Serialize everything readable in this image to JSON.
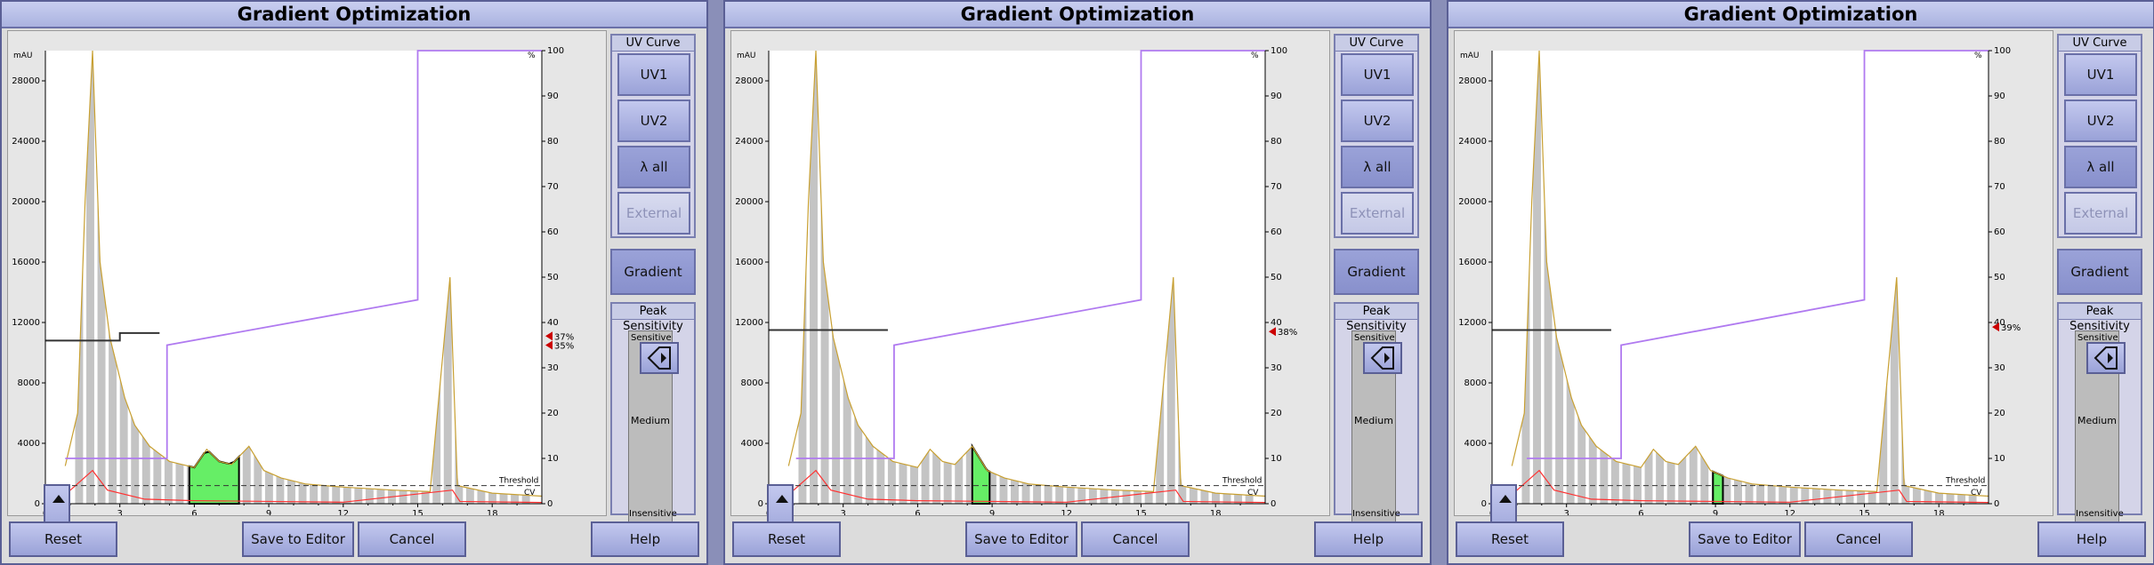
{
  "panels": [
    {
      "title": "Gradient Optimization",
      "left_axis_unit": "mAU",
      "right_axis_unit": "%",
      "threshold_label": "Threshold",
      "cv_label": "CV",
      "marker_labels": [
        "37%",
        "35%"
      ],
      "selected_peak_x": [
        5.8,
        7.8
      ],
      "uv_curve": {
        "label": "UV Curve",
        "buttons": [
          "UV1",
          "UV2",
          "λ all",
          "External"
        ],
        "pressed": [
          false,
          false,
          true,
          false
        ],
        "disabled": [
          false,
          false,
          false,
          true
        ]
      },
      "gradient_label": "Gradient",
      "peak_sensitivity": {
        "label": "Peak Sensitivity",
        "sensitive": "Sensitive",
        "medium": "Medium",
        "insensitive": "Insensitive"
      },
      "bottom_buttons": [
        "Reset",
        "Save to Editor",
        "Cancel",
        "Help"
      ]
    },
    {
      "title": "Gradient Optimization",
      "left_axis_unit": "mAU",
      "right_axis_unit": "%",
      "threshold_label": "Threshold",
      "cv_label": "CV",
      "marker_labels": [
        "38%"
      ],
      "selected_peak_x": [
        8.2,
        8.9
      ],
      "uv_curve": {
        "label": "UV Curve",
        "buttons": [
          "UV1",
          "UV2",
          "λ all",
          "External"
        ],
        "pressed": [
          false,
          false,
          true,
          false
        ],
        "disabled": [
          false,
          false,
          false,
          true
        ]
      },
      "gradient_label": "Gradient",
      "peak_sensitivity": {
        "label": "Peak Sensitivity",
        "sensitive": "Sensitive",
        "medium": "Medium",
        "insensitive": "Insensitive"
      },
      "bottom_buttons": [
        "Reset",
        "Save to Editor",
        "Cancel",
        "Help"
      ]
    },
    {
      "title": "Gradient Optimization",
      "left_axis_unit": "mAU",
      "right_axis_unit": "%",
      "threshold_label": "Threshold",
      "cv_label": "CV",
      "marker_labels": [
        "39%"
      ],
      "selected_peak_x": [
        8.9,
        9.3
      ],
      "uv_curve": {
        "label": "UV Curve",
        "buttons": [
          "UV1",
          "UV2",
          "λ all",
          "External"
        ],
        "pressed": [
          false,
          false,
          true,
          false
        ],
        "disabled": [
          false,
          false,
          false,
          true
        ]
      },
      "gradient_label": "Gradient",
      "peak_sensitivity": {
        "label": "Peak Sensitivity",
        "sensitive": "Sensitive",
        "medium": "Medium",
        "insensitive": "Insensitive"
      },
      "bottom_buttons": [
        "Reset",
        "Save to Editor",
        "Cancel",
        "Help"
      ]
    }
  ],
  "chart_data": {
    "type": "line",
    "x_ticks": [
      "0",
      "3",
      "6",
      "9",
      "12",
      "15",
      "18"
    ],
    "xlim": [
      0,
      20
    ],
    "left_ticks": [
      "0",
      "4000",
      "8000",
      "12000",
      "16000",
      "20000",
      "24000",
      "28000"
    ],
    "ylim_left": [
      0,
      30000
    ],
    "right_ticks": [
      "0",
      "10",
      "20",
      "30",
      "40",
      "50",
      "60",
      "70",
      "80",
      "90",
      "100"
    ],
    "ylim_right": [
      0,
      100
    ],
    "uv_trace": [
      [
        0.8,
        2500
      ],
      [
        1.3,
        6000
      ],
      [
        1.6,
        20000
      ],
      [
        1.9,
        30000
      ],
      [
        2.2,
        16000
      ],
      [
        2.6,
        11000
      ],
      [
        2.9,
        9000
      ],
      [
        3.2,
        7000
      ],
      [
        3.6,
        5200
      ],
      [
        4.2,
        3800
      ],
      [
        5,
        2800
      ],
      [
        6,
        2400
      ],
      [
        6.5,
        3600
      ],
      [
        7,
        2800
      ],
      [
        7.5,
        2600
      ],
      [
        8.2,
        3800
      ],
      [
        8.8,
        2200
      ],
      [
        9.5,
        1700
      ],
      [
        10.5,
        1300
      ],
      [
        12,
        1100
      ],
      [
        14,
        900
      ],
      [
        15.5,
        800
      ],
      [
        16.3,
        15000
      ],
      [
        16.6,
        1200
      ],
      [
        18,
        700
      ],
      [
        20,
        500
      ]
    ],
    "gradient": [
      [
        4.9,
        10
      ],
      [
        4.9,
        35
      ],
      [
        15,
        45
      ],
      [
        15,
        100
      ],
      [
        20,
        100
      ]
    ],
    "threshold_level": 1200,
    "cv_trace": [
      [
        0.8,
        600
      ],
      [
        1.9,
        2200
      ],
      [
        2.5,
        900
      ],
      [
        4,
        300
      ],
      [
        6,
        200
      ],
      [
        9,
        150
      ],
      [
        12,
        100
      ],
      [
        16.4,
        900
      ],
      [
        16.7,
        150
      ],
      [
        20,
        80
      ]
    ]
  }
}
